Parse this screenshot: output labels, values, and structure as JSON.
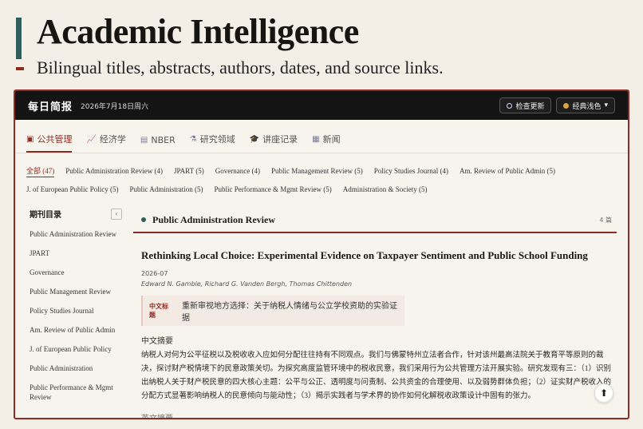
{
  "hero": {
    "title": "Academic Intelligence",
    "subtitle": "Bilingual titles, abstracts, authors, dates, and source links."
  },
  "topbar": {
    "brand": "每日简报",
    "date": "2026年7月18日周六",
    "check_update_label": "检查更新",
    "theme_label": "经典浅色",
    "theme_chevron": "▾"
  },
  "tabs": [
    {
      "label": "公共管理",
      "icon": "book-icon",
      "glyph": "▣"
    },
    {
      "label": "经济学",
      "icon": "chart-icon",
      "glyph": "📈"
    },
    {
      "label": "NBER",
      "icon": "document-icon",
      "glyph": "▤"
    },
    {
      "label": "研究领域",
      "icon": "flask-icon",
      "glyph": "⚗"
    },
    {
      "label": "讲座记录",
      "icon": "graduation-cap-icon",
      "glyph": "🎓"
    },
    {
      "label": "新闻",
      "icon": "newspaper-icon",
      "glyph": "▦"
    }
  ],
  "filters": [
    "全部 (47)",
    "Public Administration Review (4)",
    "JPART (5)",
    "Governance (4)",
    "Public Management Review (5)",
    "Policy Studies Journal (4)",
    "Am. Review of Public Admin (5)",
    "J. of European Public Policy (5)",
    "Public Administration (5)",
    "Public Performance & Mgmt Review (5)",
    "Administration & Society (5)"
  ],
  "sidebar": {
    "title": "期刊目录",
    "collapse_glyph": "‹",
    "items": [
      "Public Administration Review",
      "JPART",
      "Governance",
      "Public Management Review",
      "Policy Studies Journal",
      "Am. Review of Public Admin",
      "J. of European Public Policy",
      "Public Administration",
      "Public Performance & Mgmt Review"
    ]
  },
  "section": {
    "title": "Public Administration Review",
    "count": "4 篇"
  },
  "article": {
    "title": "Rethinking Local Choice: Experimental Evidence on Taxpayer Sentiment and Public School Funding",
    "date": "2026-07",
    "authors": "Edward N. Gamble, Richard G. Vanden Bergh, Thomas Chittenden",
    "cn_badge": "中文标题",
    "cn_title": "重新审视地方选择：关于纳税人情绪与公立学校资助的实验证据",
    "abs_label": "中文摘要",
    "abs_text": "纳税人对何为公平征税以及税收收入应如何分配往往持有不同观点。我们与佛蒙特州立法者合作，针对该州最高法院关于教育平等原则的裁决，探讨财产税情境下的民意政策关切。为探究高度监管环境中的税收民意，我们采用行为公共管理方法开展实验。研究发现有三：（1）识别出纳税人关于财产税民意的四大核心主题：公平与公正、透明度与问责制、公共资金的合理使用、以及弱势群体负担；（2）证实财产税收入的分配方式显著影响纳税人的民意倾向与能动性；（3）揭示实践者与学术界的协作如何化解税收政策设计中固有的张力。",
    "en_label": "英文摘要"
  },
  "scroll_top_glyph": "⬆"
}
